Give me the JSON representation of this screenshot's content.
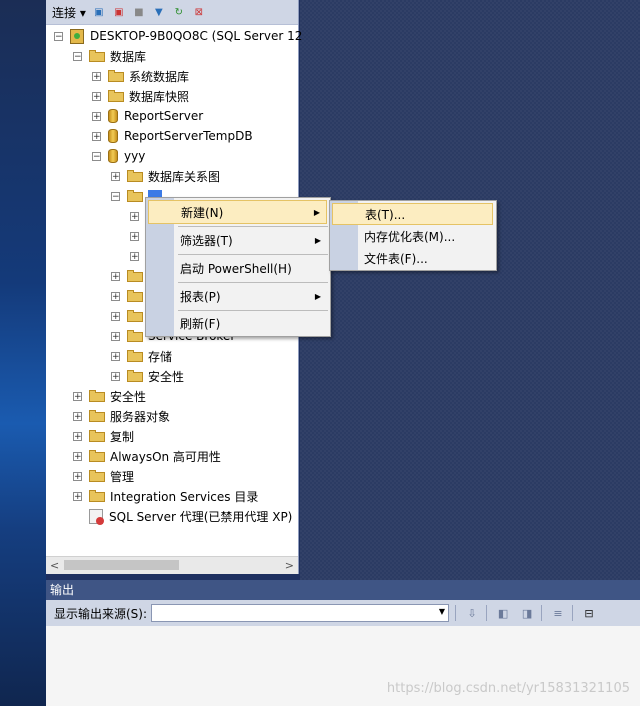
{
  "toolbar": {
    "connect_label": "连接 ▾"
  },
  "tree": {
    "server": "DESKTOP-9B0QO8C (SQL Server 12",
    "databases": "数据库",
    "system_dbs": "系统数据库",
    "snapshots": "数据库快照",
    "report_server": "ReportServer",
    "report_server_temp": "ReportServerTempDB",
    "yyy": "yyy",
    "diagrams": "数据库关系图",
    "service_broker": "Service Broker",
    "storage": "存储",
    "db_security": "安全性",
    "security": "安全性",
    "server_objects": "服务器对象",
    "replication": "复制",
    "alwayson": "AlwaysOn 高可用性",
    "management": "管理",
    "integration": "Integration Services 目录",
    "agent": "SQL Server 代理(已禁用代理 XP)"
  },
  "context_menu": {
    "new": "新建(N)",
    "filter": "筛选器(T)",
    "powershell": "启动 PowerShell(H)",
    "reports": "报表(P)",
    "refresh": "刷新(F)"
  },
  "submenu": {
    "table": "表(T)...",
    "memory_table": "内存优化表(M)...",
    "file_table": "文件表(F)..."
  },
  "output": {
    "title": "输出",
    "source_label": "显示输出来源(S):",
    "source_value": ""
  },
  "watermark": "https://blog.csdn.net/yr15831321105"
}
